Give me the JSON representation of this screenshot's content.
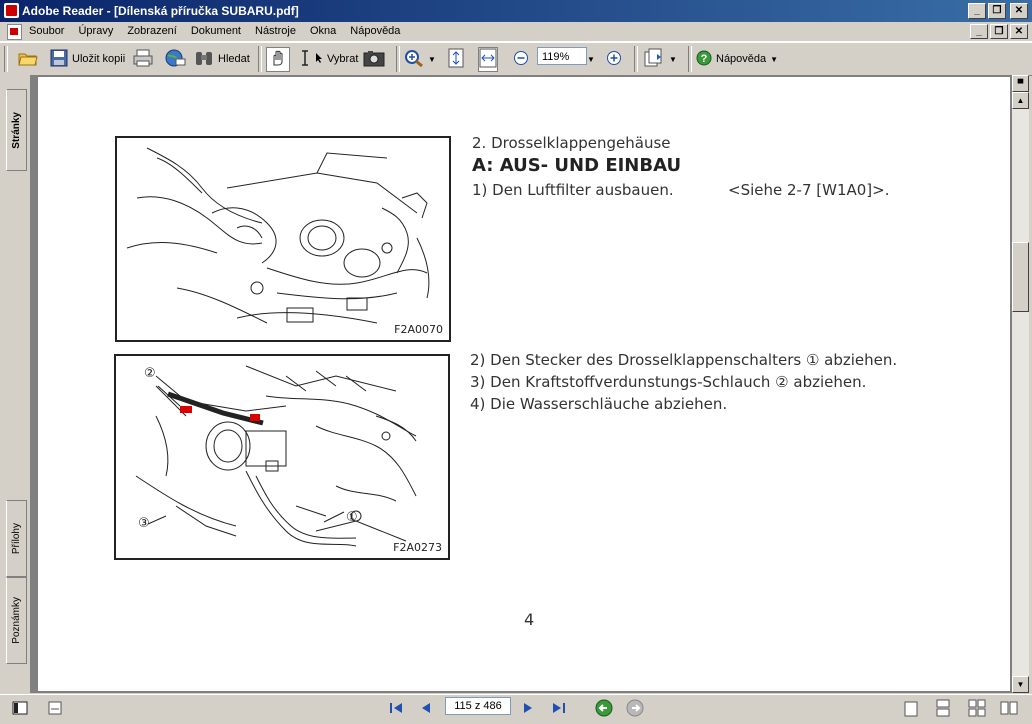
{
  "window": {
    "title": "Adobe Reader - [Dílenská příručka SUBARU.pdf]"
  },
  "menubar": {
    "items": [
      "Soubor",
      "Úpravy",
      "Zobrazení",
      "Dokument",
      "Nástroje",
      "Okna",
      "Nápověda"
    ]
  },
  "toolbar": {
    "save_copy_label": "Uložit kopii",
    "search_label": "Hledat",
    "select_label": "Vybrat",
    "zoom_value": "119%",
    "help_label": "Nápověda"
  },
  "sidebar": {
    "tabs": [
      "Stránky",
      "Přílohy",
      "Poznámky"
    ]
  },
  "document": {
    "section_heading": "2. Drosselklappengehäuse",
    "main_heading": "A: AUS- UND EINBAU",
    "step1_text": "1) Den Luftfilter ausbauen.",
    "step1_ref": "<Siehe 2-7 [W1A0]>.",
    "step2": "2) Den Stecker des Drosselklappenschalters ① abziehen.",
    "step3": "3) Den Kraftstoffverdunstungs-Schlauch ② abziehen.",
    "step4": "4) Die Wasserschläuche abziehen.",
    "figure1_code": "F2A0070",
    "figure2_code": "F2A0273",
    "figure2_callout1": "①",
    "figure2_callout2": "②",
    "figure2_callout3": "③",
    "page_number": "4"
  },
  "statusbar": {
    "page_indicator": "115 z 486"
  }
}
